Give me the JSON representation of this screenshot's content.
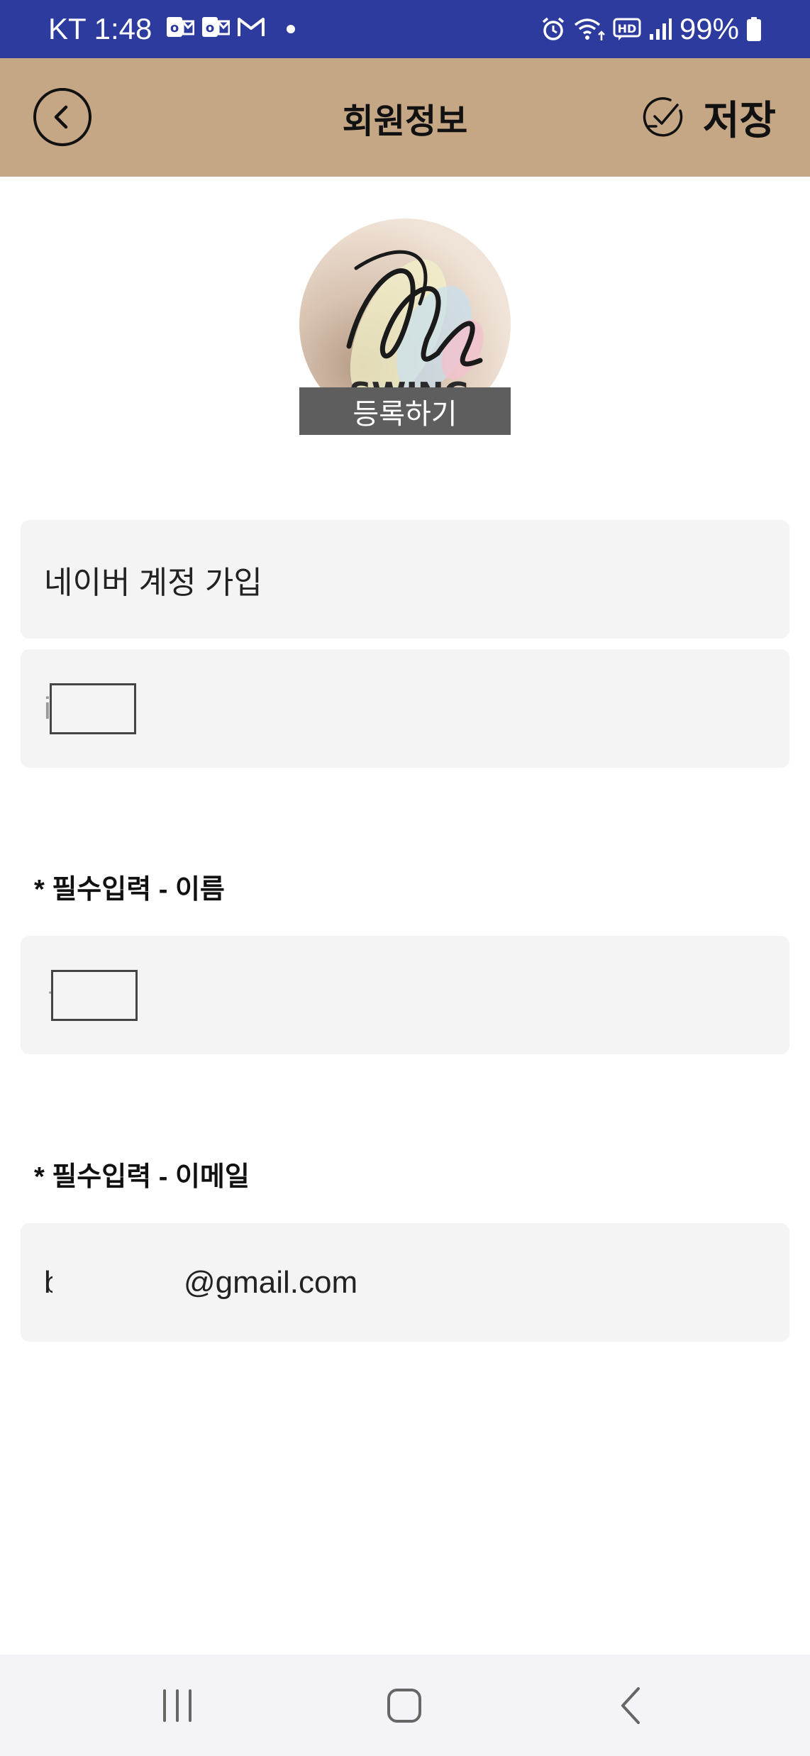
{
  "status_bar": {
    "carrier_time": "KT 1:48",
    "notification_icons": [
      "outlook-icon",
      "outlook-icon",
      "gmail-icon"
    ],
    "system_icons": [
      "alarm-icon",
      "wifi-icon",
      "hd-icon",
      "signal-icon",
      "battery-icon"
    ],
    "battery_level": "99%",
    "bar_color": "#2d3a9e"
  },
  "header": {
    "title": "회원정보",
    "save_label": "저장",
    "back_icon": "chevron-left-icon",
    "save_icon": "check-circle-icon",
    "bar_color": "#c5a786"
  },
  "profile": {
    "register_button_label": "등록하기",
    "avatar_icon": "swing-logo-image",
    "avatar_logo_text": "SWING"
  },
  "fields": {
    "signup_type": "네이버 계정 가입",
    "account_id_visible": "i",
    "name_label": "* 필수입력 - 이름",
    "name_visible": "ㅎ",
    "email_label": "* 필수입력 - 이메일",
    "email_prefix_visible": "b",
    "email_suffix": "@gmail.com"
  },
  "nav_bar": {
    "icons": [
      "recents-icon",
      "home-icon",
      "back-icon"
    ]
  }
}
